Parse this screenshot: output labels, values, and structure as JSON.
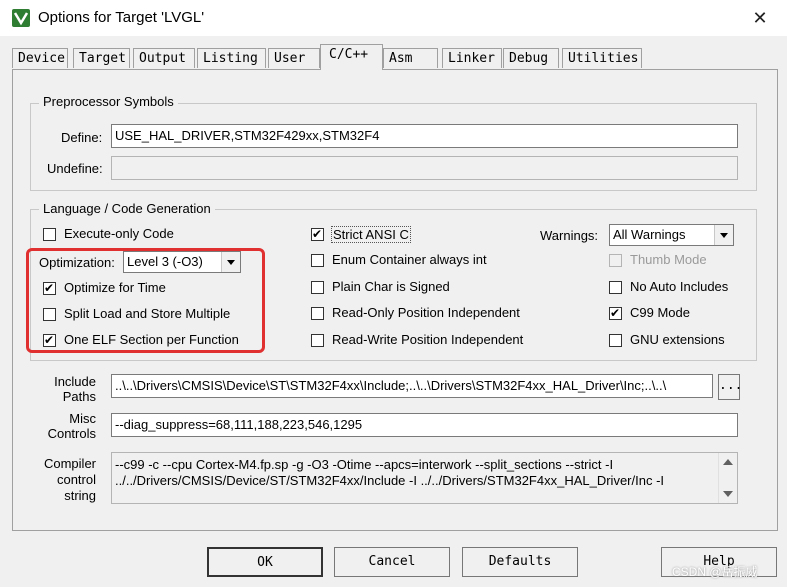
{
  "window": {
    "title": "Options for Target 'LVGL'",
    "close_glyph": "✕"
  },
  "tabs": [
    "Device",
    "Target",
    "Output",
    "Listing",
    "User",
    "C/C++",
    "Asm",
    "Linker",
    "Debug",
    "Utilities"
  ],
  "active_tab": "C/C++",
  "preprocessor": {
    "group_title": "Preprocessor Symbols",
    "define_label": "Define:",
    "define_value": "USE_HAL_DRIVER,STM32F429xx,STM32F4",
    "undefine_label": "Undefine:",
    "undefine_value": ""
  },
  "codegen": {
    "group_title": "Language / Code Generation",
    "execute_only": {
      "label": "Execute-only Code",
      "checked": false
    },
    "optimization_label": "Optimization:",
    "optimization_value": "Level 3 (-O3)",
    "optimize_time": {
      "label": "Optimize for Time",
      "checked": true
    },
    "split_load": {
      "label": "Split Load and Store Multiple",
      "checked": false
    },
    "one_elf": {
      "label": "One ELF Section per Function",
      "checked": true
    },
    "strict_ansi": {
      "label": "Strict ANSI C",
      "checked": true
    },
    "enum_container": {
      "label": "Enum Container always int",
      "checked": false
    },
    "plain_char": {
      "label": "Plain Char is Signed",
      "checked": false
    },
    "ro_pi": {
      "label": "Read-Only Position Independent",
      "checked": false
    },
    "rw_pi": {
      "label": "Read-Write Position Independent",
      "checked": false
    },
    "warnings_label": "Warnings:",
    "warnings_value": "All Warnings",
    "thumb_mode": {
      "label": "Thumb Mode",
      "checked": false,
      "disabled": true
    },
    "no_auto_includes": {
      "label": "No Auto Includes",
      "checked": false
    },
    "c99_mode": {
      "label": "C99 Mode",
      "checked": true
    },
    "gnu_ext": {
      "label": "GNU extensions",
      "checked": false
    }
  },
  "paths": {
    "include_label_1": "Include",
    "include_label_2": "Paths",
    "include_value": "..\\..\\Drivers\\CMSIS\\Device\\ST\\STM32F4xx\\Include;..\\..\\Drivers\\STM32F4xx_HAL_Driver\\Inc;..\\..\\",
    "browse_label": "...",
    "misc_label_1": "Misc",
    "misc_label_2": "Controls",
    "misc_value": "--diag_suppress=68,111,188,223,546,1295",
    "compiler_label_1": "Compiler",
    "compiler_label_2": "control",
    "compiler_label_3": "string",
    "compiler_line_1": "--c99 -c --cpu Cortex-M4.fp.sp -g -O3 -Otime --apcs=interwork --split_sections --strict -I",
    "compiler_line_2": "../../Drivers/CMSIS/Device/ST/STM32F4xx/Include -I ../../Drivers/STM32F4xx_HAL_Driver/Inc -I"
  },
  "buttons": {
    "ok": "OK",
    "cancel": "Cancel",
    "defaults": "Defaults",
    "help": "Help"
  },
  "watermark": "CSDN @岳振威",
  "colors": {
    "highlight": "#e03030",
    "icon": "#2e7d32"
  }
}
